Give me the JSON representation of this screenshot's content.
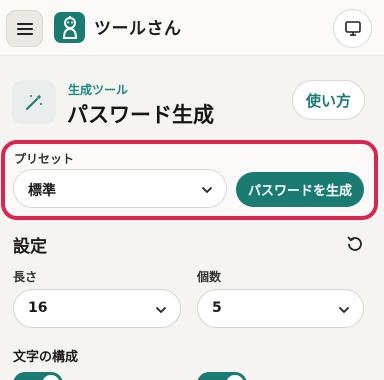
{
  "header": {
    "brand": "ツールさん",
    "menu_icon": "hamburger-menu-icon",
    "logo_icon": "robot-mascot-icon",
    "display_icon": "monitor-icon"
  },
  "tool": {
    "icon": "magic-wand-icon",
    "eyebrow": "生成ツール",
    "title": "パスワード生成",
    "howto_label": "使い方"
  },
  "preset": {
    "label": "プリセット",
    "selected": "標準",
    "generate_label": "パスワードを生成"
  },
  "settings": {
    "title": "設定",
    "reset_icon": "reset-icon",
    "length_label": "長さ",
    "length_value": "16",
    "count_label": "個数",
    "count_value": "5",
    "chars_title": "文字の構成"
  },
  "colors": {
    "accent": "#1a7b72",
    "highlight": "#d8274f",
    "background": "#f6f4f0"
  }
}
